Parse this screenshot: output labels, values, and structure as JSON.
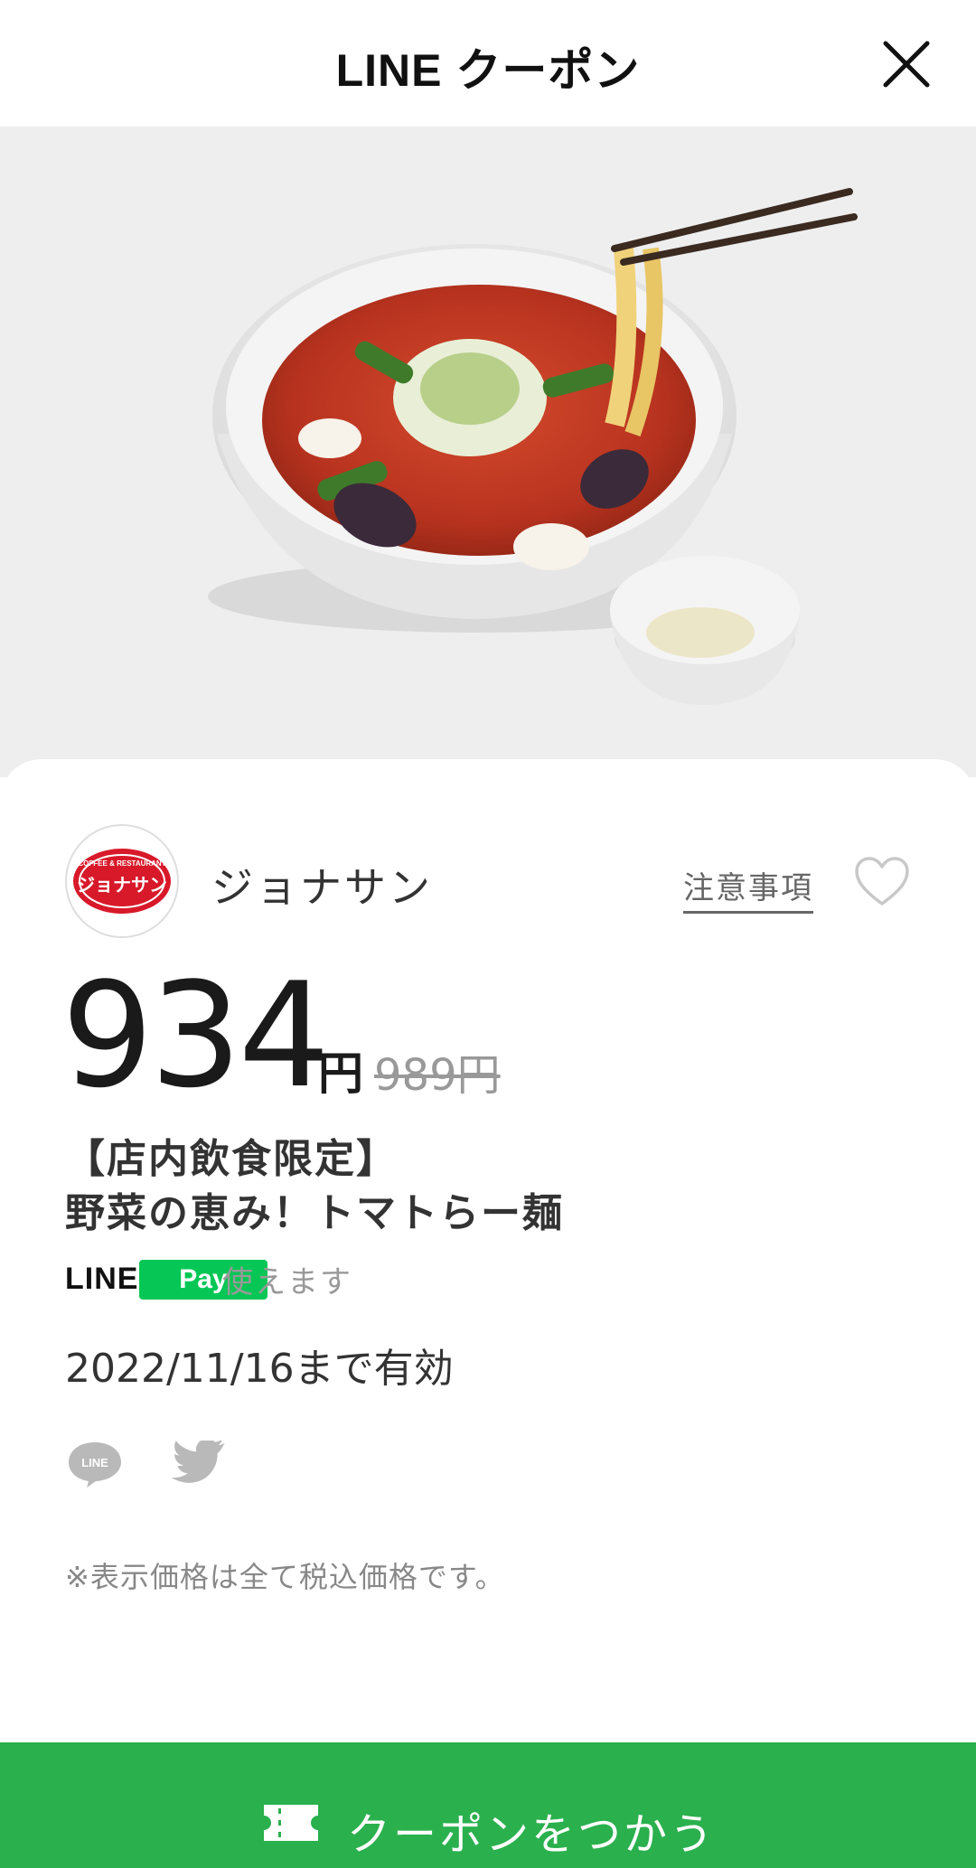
{
  "header": {
    "title": "LINE クーポン",
    "close_icon": "close-icon"
  },
  "hero": {
    "icon": "ramen-bowl-photo"
  },
  "shop": {
    "name": "ジョナサン",
    "logo_lines": [
      "COFFEE & RESTAURANT",
      "ジョナサン"
    ],
    "notice_label": "注意事項",
    "favorite_icon": "heart-icon"
  },
  "coupon": {
    "price": "934",
    "price_unit": "円",
    "original_price": "989円",
    "title_line1": "【店内飲食限定】",
    "title_line2": "野菜の恵み！トマトらー麺",
    "pay_brand": "LINE",
    "pay_badge": "Pay",
    "pay_status": "使えます",
    "valid_until": "2022/11/16まで有効",
    "tax_note": "※表示価格は全て税込価格です。"
  },
  "share": {
    "line_label": "LINE",
    "line_icon": "line-share-icon",
    "twitter_icon": "twitter-share-icon"
  },
  "action": {
    "use_label": "クーポンをつかう",
    "ticket_icon": "ticket-icon"
  },
  "colors": {
    "accent_green": "#2ab04d",
    "line_pay_green": "#06c755",
    "logo_red": "#d8192a",
    "hero_bg": "#eeeeee"
  }
}
